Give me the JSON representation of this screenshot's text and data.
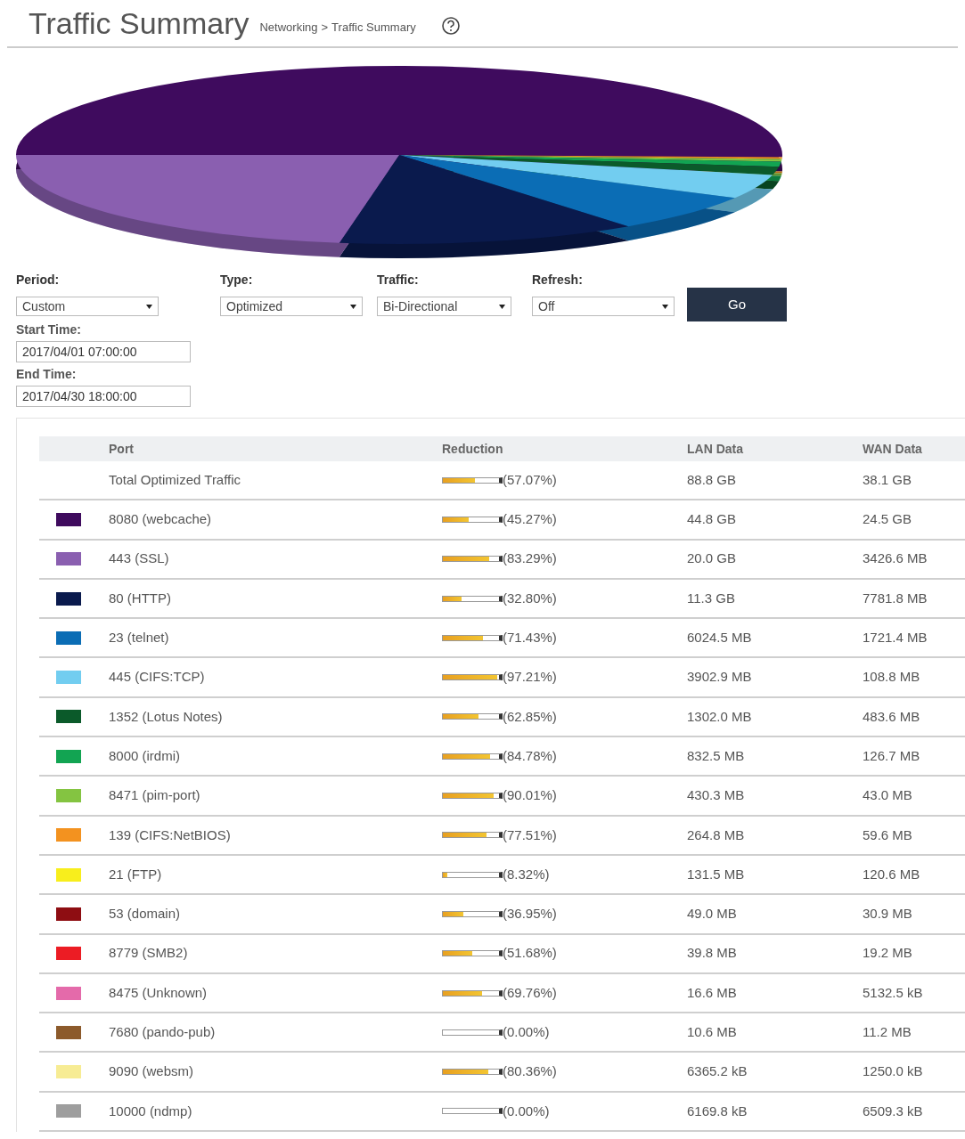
{
  "header": {
    "title": "Traffic Summary",
    "breadcrumb": [
      "Networking",
      "Traffic Summary"
    ],
    "separator": ">"
  },
  "controls": [
    {
      "label": "Period:",
      "value": "Custom"
    },
    {
      "label": "Type:",
      "value": "Optimized"
    },
    {
      "label": "Traffic:",
      "value": "Bi-Directional"
    },
    {
      "label": "Refresh:",
      "value": "Off"
    }
  ],
  "go_button": "Go",
  "times": [
    {
      "label": "Start Time:",
      "value": "2017/04/01 07:00:00"
    },
    {
      "label": "End Time:",
      "value": "2017/04/30 18:00:00"
    }
  ],
  "table": {
    "columns": [
      "Port",
      "Reduction",
      "LAN Data",
      "WAN Data"
    ],
    "rows": [
      {
        "port": "Total Optimized Traffic",
        "level": 0.5707,
        "reduction": "(57.07%)",
        "lan": "88.8 GB",
        "wan": "38.1 GB"
      },
      {
        "port": "8080 (webcache)",
        "color": "#3f0b5e",
        "level": 0.4527,
        "reduction": "(45.27%)",
        "lan": "44.8 GB",
        "wan": "24.5 GB"
      },
      {
        "port": "443 (SSL)",
        "color": "#8a5fb0",
        "level": 0.8329,
        "reduction": "(83.29%)",
        "lan": "20.0 GB",
        "wan": "3426.6 MB"
      },
      {
        "port": "80 (HTTP)",
        "color": "#0a1a4d",
        "level": 0.328,
        "reduction": "(32.80%)",
        "lan": "11.3 GB",
        "wan": "7781.8 MB"
      },
      {
        "port": "23 (telnet)",
        "color": "#0b6db5",
        "level": 0.7143,
        "reduction": "(71.43%)",
        "lan": "6024.5 MB",
        "wan": "1721.4 MB"
      },
      {
        "port": "445 (CIFS:TCP)",
        "color": "#72cdf0",
        "level": 0.9721,
        "reduction": "(97.21%)",
        "lan": "3902.9 MB",
        "wan": "108.8 MB"
      },
      {
        "port": "1352 (Lotus Notes)",
        "color": "#0b5a2a",
        "level": 0.6285,
        "reduction": "(62.85%)",
        "lan": "1302.0 MB",
        "wan": "483.6 MB"
      },
      {
        "port": "8000 (irdmi)",
        "color": "#12a452",
        "level": 0.8478,
        "reduction": "(84.78%)",
        "lan": "832.5 MB",
        "wan": "126.7 MB"
      },
      {
        "port": "8471 (pim-port)",
        "color": "#84c441",
        "level": 0.9001,
        "reduction": "(90.01%)",
        "lan": "430.3 MB",
        "wan": "43.0 MB"
      },
      {
        "port": "139 (CIFS:NetBIOS)",
        "color": "#f3921f",
        "level": 0.7751,
        "reduction": "(77.51%)",
        "lan": "264.8 MB",
        "wan": "59.6 MB"
      },
      {
        "port": "21 (FTP)",
        "color": "#f8ee1c",
        "level": 0.0832,
        "reduction": "(8.32%)",
        "lan": "131.5 MB",
        "wan": "120.6 MB"
      },
      {
        "port": "53 (domain)",
        "color": "#8e0d12",
        "level": 0.3695,
        "reduction": "(36.95%)",
        "lan": "49.0 MB",
        "wan": "30.9 MB"
      },
      {
        "port": "8779 (SMB2)",
        "color": "#ec1c24",
        "level": 0.5168,
        "reduction": "(51.68%)",
        "lan": "39.8 MB",
        "wan": "19.2 MB"
      },
      {
        "port": "8475 (Unknown)",
        "color": "#e46aaa",
        "level": 0.6976,
        "reduction": "(69.76%)",
        "lan": "16.6 MB",
        "wan": "5132.5 kB"
      },
      {
        "port": "7680 (pando-pub)",
        "color": "#8c5a2b",
        "level": 0,
        "reduction": "(0.00%)",
        "lan": "10.6 MB",
        "wan": "11.2 MB"
      },
      {
        "port": "9090 (websm)",
        "color": "#f7ec94",
        "level": 0.8036,
        "reduction": "(80.36%)",
        "lan": "6365.2 kB",
        "wan": "1250.0 kB"
      },
      {
        "port": "10000 (ndmp)",
        "color": "#9e9e9e",
        "level": 0,
        "reduction": "(0.00%)",
        "lan": "6169.8 kB",
        "wan": "6509.3 kB"
      }
    ]
  }
}
